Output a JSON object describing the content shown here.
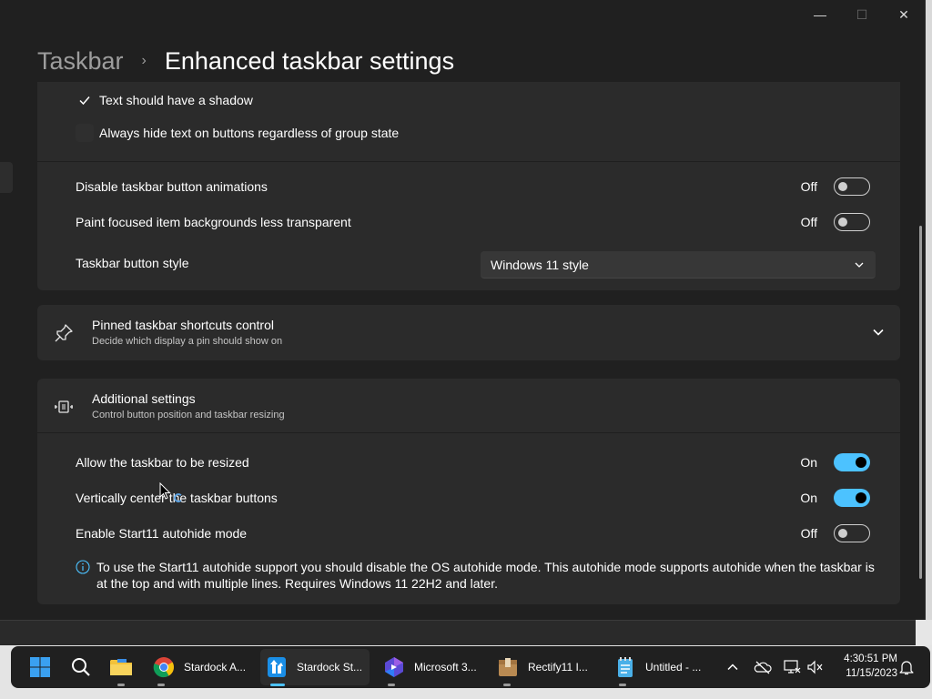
{
  "window": {
    "controls": {
      "minimize": "—",
      "maximize": "☐",
      "close": "✕"
    }
  },
  "header": {
    "parent": "Taskbar",
    "separator": "›",
    "current": "Enhanced taskbar settings"
  },
  "top_card": {
    "checkboxes": [
      {
        "label": "Text should have a shadow",
        "checked": true
      },
      {
        "label": "Always hide text on buttons regardless of group state",
        "checked": false
      }
    ],
    "toggles": [
      {
        "label": "Disable taskbar button animations",
        "state": "Off"
      },
      {
        "label": "Paint focused item backgrounds less transparent",
        "state": "Off"
      }
    ],
    "button_style": {
      "label": "Taskbar button style",
      "value": "Windows 11 style"
    }
  },
  "pinned": {
    "icon": "pin-icon",
    "title": "Pinned taskbar shortcuts control",
    "description": "Decide which display a pin should show on"
  },
  "additional": {
    "icon": "resize-icon",
    "title": "Additional settings",
    "description": "Control button position and taskbar resizing",
    "toggles": [
      {
        "label": "Allow the taskbar to be resized",
        "state": "On"
      },
      {
        "label": "Vertically center the taskbar buttons",
        "state": "On"
      },
      {
        "label": "Enable Start11 autohide mode",
        "state": "Off"
      }
    ],
    "info_text": "To use the Start11 autohide support you should disable the OS autohide mode.  This autohide mode supports autohide when the taskbar is at the top and with multiple lines.  Requires Windows 11 22H2 and later."
  },
  "taskbar": {
    "apps": [
      {
        "label": "Stardock A...",
        "icon": "chrome-icon"
      },
      {
        "label": "Stardock St...",
        "icon": "stardock-icon"
      },
      {
        "label": "Microsoft 3...",
        "icon": "copilot-icon"
      },
      {
        "label": "Rectify11 I...",
        "icon": "package-icon"
      },
      {
        "label": "Untitled - ...",
        "icon": "notepad-icon"
      }
    ],
    "time": "4:30:51 PM",
    "date": "11/15/2023"
  },
  "colors": {
    "accent": "#4cc2ff",
    "card": "#2b2b2b",
    "background": "#202020"
  }
}
